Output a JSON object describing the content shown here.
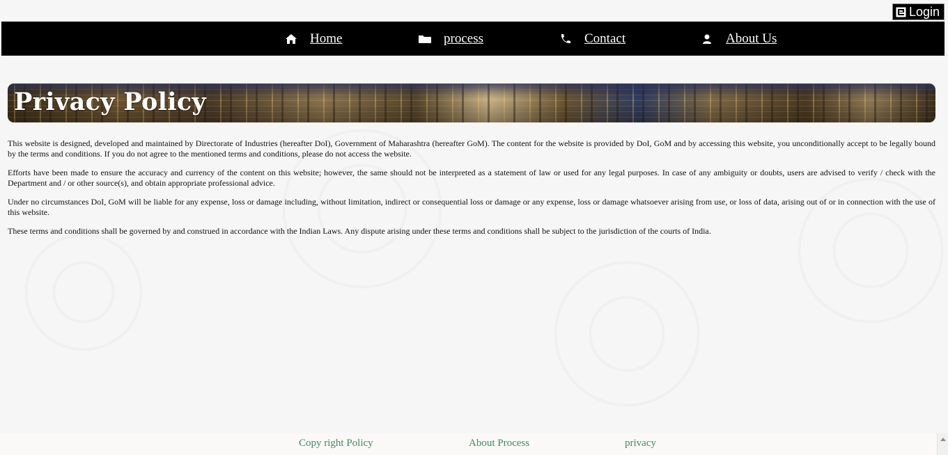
{
  "login": {
    "label": "Login",
    "icon": "login-icon"
  },
  "nav": {
    "items": [
      {
        "label": "Home",
        "icon": "home-icon"
      },
      {
        "label": "process",
        "icon": "folder-icon"
      },
      {
        "label": "Contact",
        "icon": "phone-icon"
      },
      {
        "label": "About Us",
        "icon": "user-icon"
      }
    ]
  },
  "banner": {
    "title": "Privacy Policy"
  },
  "content": {
    "paragraphs": [
      "This website is designed, developed and maintained by Directorate of Industries (hereafter DoI), Government of Maharashtra (hereafter GoM). The content for the website is provided by DoI, GoM and by accessing this website, you unconditionally accept to be legally bound by the terms and conditions. If you do not agree to the mentioned terms and conditions, please do not access the website.",
      "Efforts have been made to ensure the accuracy and currency of the content on this website; however, the same should not be interpreted as a statement of law or used for any legal purposes. In case of any ambiguity or doubts, users are advised to verify / check with the Department and / or other source(s), and obtain appropriate professional advice.",
      "Under no circumstances DoI, GoM will be liable for any expense, loss or damage including, without limitation, indirect or consequential loss or damage or any expense, loss or damage whatsoever arising from use, or loss of data, arising out of or in connection with the use of this website.",
      "These terms and conditions shall be governed by and construed in accordance with the Indian Laws. Any dispute arising under these terms and conditions shall be subject to the jurisdiction of the courts of India."
    ]
  },
  "footer": {
    "links": [
      {
        "label": "Copy right Policy"
      },
      {
        "label": "About Process"
      },
      {
        "label": "privacy"
      }
    ]
  },
  "colors": {
    "navbar": "#000000",
    "footer_link": "#3c8c5a",
    "page_background": "#f6f6f6"
  }
}
